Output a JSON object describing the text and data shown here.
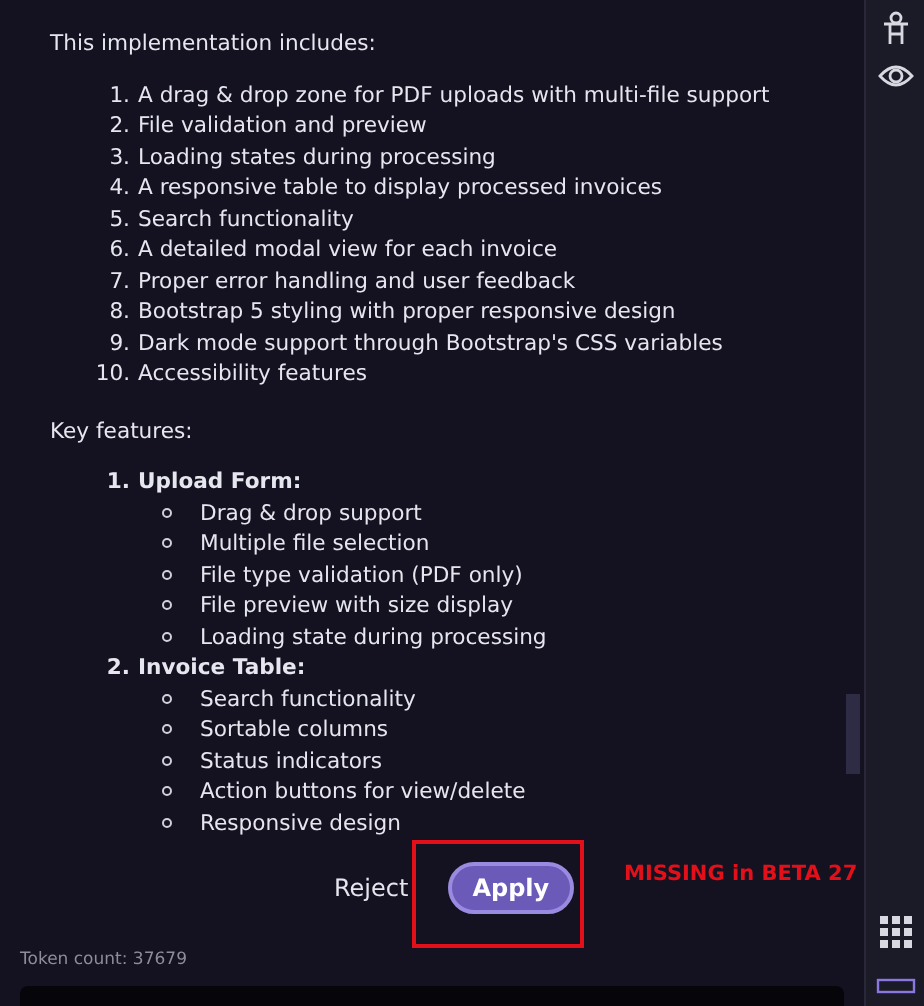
{
  "message": {
    "intro": "This implementation includes:",
    "includes": [
      {
        "number": "1.",
        "text": "A drag & drop zone for PDF uploads with multi-file support"
      },
      {
        "number": "2.",
        "text": "File validation and preview"
      },
      {
        "number": "3.",
        "text": "Loading states during processing"
      },
      {
        "number": "4.",
        "text": "A responsive table to display processed invoices"
      },
      {
        "number": "5.",
        "text": "Search functionality"
      },
      {
        "number": "6.",
        "text": "A detailed modal view for each invoice"
      },
      {
        "number": "7.",
        "text": "Proper error handling and user feedback"
      },
      {
        "number": "8.",
        "text": "Bootstrap 5 styling with proper responsive design"
      },
      {
        "number": "9.",
        "text": "Dark mode support through Bootstrap's CSS variables"
      },
      {
        "number": "10.",
        "text": "Accessibility features"
      }
    ],
    "features_heading": "Key features:",
    "features": [
      {
        "number": "1.",
        "title": "Upload Form:",
        "children": [
          "Drag & drop support",
          "Multiple file selection",
          "File type validation (PDF only)",
          "File preview with size display",
          "Loading state during processing"
        ]
      },
      {
        "number": "2.",
        "title": "Invoice Table:",
        "children": [
          "Search functionality",
          "Sortable columns",
          "Status indicators",
          "Action buttons for view/delete",
          "Responsive design"
        ]
      }
    ]
  },
  "actions": {
    "reject": "Reject",
    "apply": "Apply"
  },
  "annotation": "MISSING in BETA 27",
  "token_count": "Token count: 37679"
}
